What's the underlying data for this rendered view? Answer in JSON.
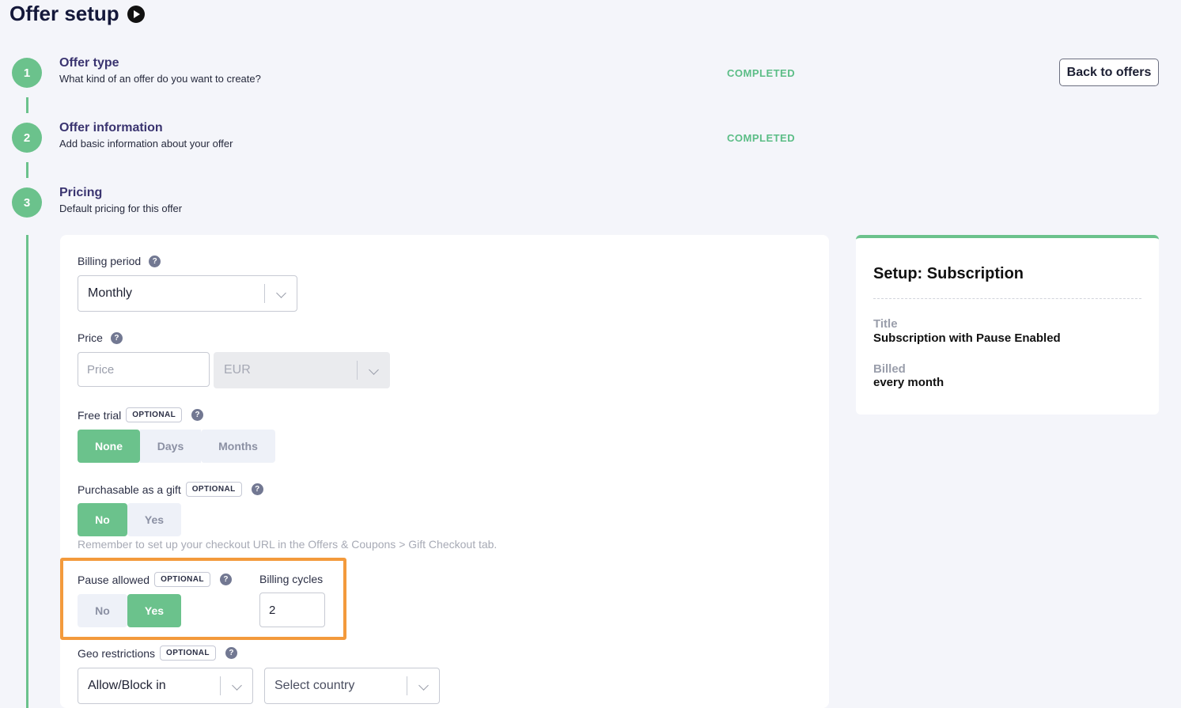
{
  "page": {
    "title": "Offer setup"
  },
  "header": {
    "back_label": "Back to offers"
  },
  "steps": [
    {
      "number": "1",
      "title": "Offer type",
      "description": "What kind of an offer do you want to create?",
      "status": "COMPLETED"
    },
    {
      "number": "2",
      "title": "Offer information",
      "description": "Add basic information about your offer",
      "status": "COMPLETED"
    },
    {
      "number": "3",
      "title": "Pricing",
      "description": "Default pricing for this offer",
      "status": ""
    }
  ],
  "form": {
    "billing_period": {
      "label": "Billing period",
      "value": "Monthly"
    },
    "price": {
      "label": "Price",
      "placeholder": "Price",
      "value": "",
      "currency": "EUR"
    },
    "free_trial": {
      "label": "Free trial",
      "badge": "OPTIONAL",
      "options": [
        "None",
        "Days",
        "Months"
      ],
      "selected": "None"
    },
    "gift": {
      "label": "Purchasable as a gift",
      "badge": "OPTIONAL",
      "options": [
        "No",
        "Yes"
      ],
      "selected": "No",
      "hint": "Remember to set up your checkout URL in the Offers & Coupons > Gift Checkout tab."
    },
    "pause": {
      "label": "Pause allowed",
      "badge": "OPTIONAL",
      "options": [
        "No",
        "Yes"
      ],
      "selected": "Yes"
    },
    "billing_cycles": {
      "label": "Billing cycles",
      "value": "2"
    },
    "geo": {
      "label": "Geo restrictions",
      "badge": "OPTIONAL",
      "mode": "Allow/Block in",
      "country": "Select country"
    }
  },
  "summary": {
    "title": "Setup: Subscription",
    "items": [
      {
        "label": "Title",
        "value": "Subscription with Pause Enabled"
      },
      {
        "label": "Billed",
        "value": "every month"
      }
    ]
  },
  "colors": {
    "accent": "#6bc28c",
    "highlight": "#f39a3c",
    "step_title": "#3a3470"
  },
  "icons": {
    "play": "play-icon",
    "help": "help-icon",
    "chevron": "chevron-down-icon"
  }
}
